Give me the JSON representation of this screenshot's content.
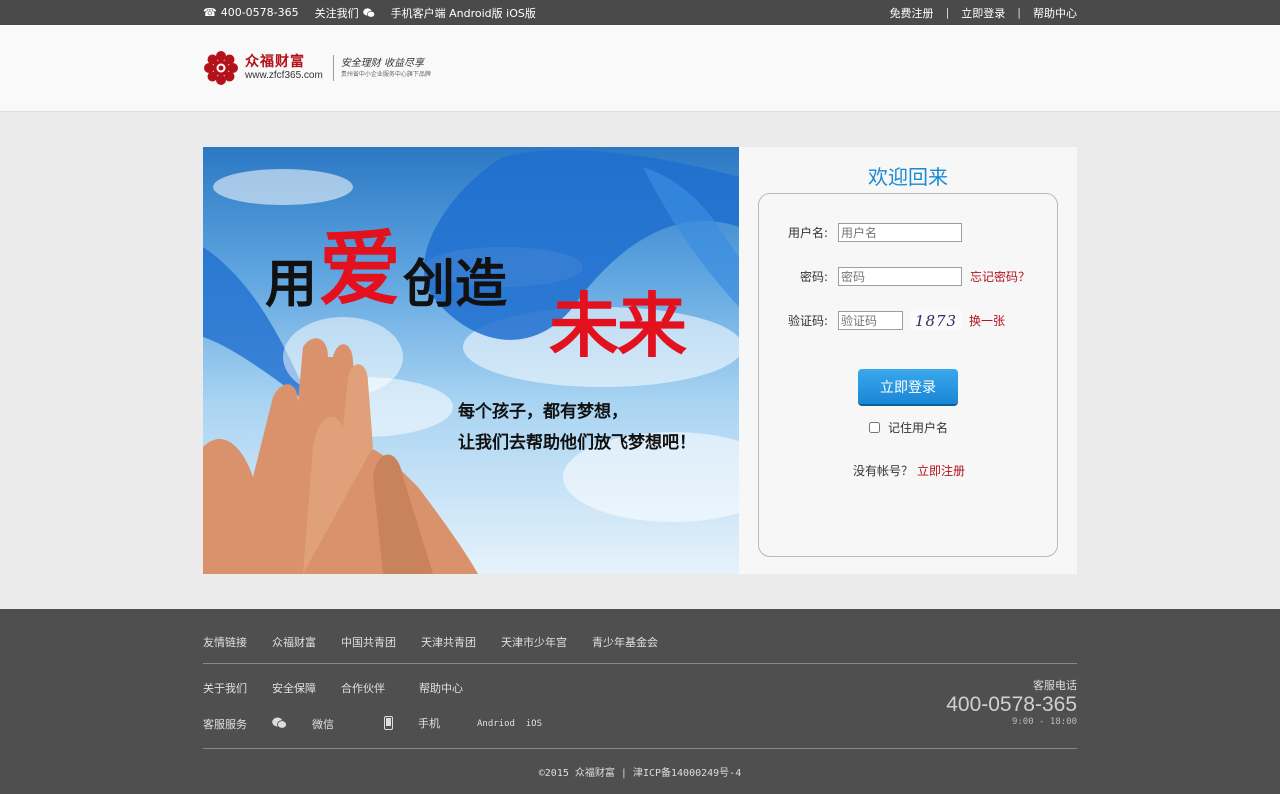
{
  "topbar": {
    "phone": "400-0578-365",
    "follow": "关注我们",
    "mobile": "手机客户端 Android版 iOS版",
    "register": "免费注册",
    "login": "立即登录",
    "help": "帮助中心"
  },
  "header": {
    "logo_name": "众福财富",
    "logo_url": "www.zfcf365.com",
    "slogan": "安全理财 收益尽享",
    "slogan_sub": "贵州省中小企业服务中心旗下品牌"
  },
  "banner": {
    "title_1": "用",
    "title_love": "爱",
    "title_2": "创造",
    "title_future": "未来",
    "line1": "每个孩子，都有梦想，",
    "line2": "让我们去帮助他们放飞梦想吧！"
  },
  "login": {
    "welcome": "欢迎回来",
    "username_label": "用户名:",
    "username_placeholder": "用户名",
    "password_label": "密码:",
    "password_placeholder": "密码",
    "forgot": "忘记密码？",
    "captcha_label": "验证码:",
    "captcha_placeholder": "验证码",
    "captcha_value": "1873",
    "refresh": "换一张",
    "submit": "立即登录",
    "remember": "记住用户名",
    "no_account": "没有帐号？",
    "register_link": "立即注册"
  },
  "footer": {
    "links_title": "友情链接",
    "links": [
      "众福财富",
      "中国共青团",
      "天津共青团",
      "天津市少年宫",
      "青少年基金会"
    ],
    "nav": [
      "关于我们",
      "安全保障",
      "合作伙伴",
      "帮助中心"
    ],
    "service": "客服服务",
    "wechat": "微信",
    "phone": "手机",
    "platforms": "Andriod  iOS",
    "hotline_label": "客服电话",
    "hotline": "400-0578-365",
    "hours": "9:00 - 18:00",
    "copyright": "©2015  众福财富 | 津ICP备14000249号-4"
  },
  "colors": {
    "brand_red": "#b3121b",
    "accent_blue": "#1a8ad3",
    "footer_bg": "#4f4f4f"
  }
}
